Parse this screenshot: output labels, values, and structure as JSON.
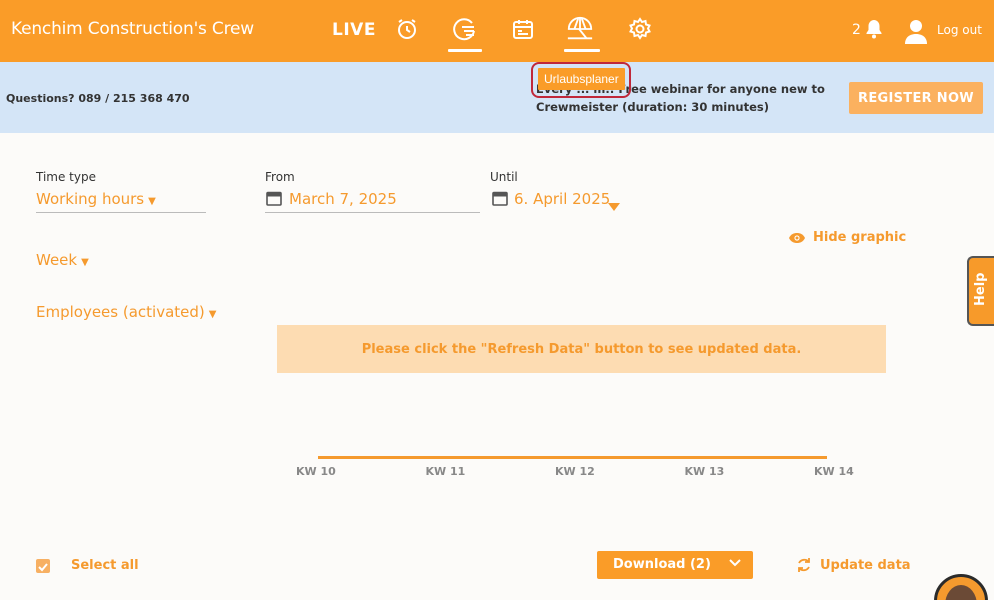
{
  "header": {
    "brand": "Kenchim Construction's Crew",
    "live_label": "LIVE",
    "nav_icons": [
      "alarm-clock-icon",
      "timesheet-icon",
      "calendar-icon",
      "vacation-icon",
      "gear-icon"
    ],
    "notification_count": "2",
    "logout_label": "Log out"
  },
  "tooltip": {
    "text": "Urlaubsplaner"
  },
  "banner": {
    "questions": "Questions? 089 / 215 368 470",
    "webinar_text": "Every ... m.: Free webinar for anyone new to Crewmeister (duration: 30 minutes)",
    "register_label": "REGISTER NOW"
  },
  "filters": {
    "time_type_label": "Time type",
    "time_type_value": "Working hours",
    "from_label": "From",
    "from_value": "March 7, 2025",
    "until_label": "Until",
    "until_value": "6. April 2025",
    "period_value": "Week",
    "employees_value": "Employees (activated)"
  },
  "graphic": {
    "hide_label": "Hide graphic",
    "notice": "Please click the \"Refresh Data\" button to see updated data."
  },
  "chart_data": {
    "type": "line",
    "categories": [
      "KW 10",
      "KW 11",
      "KW 12",
      "KW 13",
      "KW 14"
    ]
  },
  "help_label": "Help",
  "footer": {
    "select_all": "Select all",
    "download_label": "Download (2)",
    "update_label": "Update data"
  },
  "colors": {
    "accent": "#fa9c28",
    "banner_bg": "#d4e5f7",
    "notice_bg": "#fddcb2"
  }
}
